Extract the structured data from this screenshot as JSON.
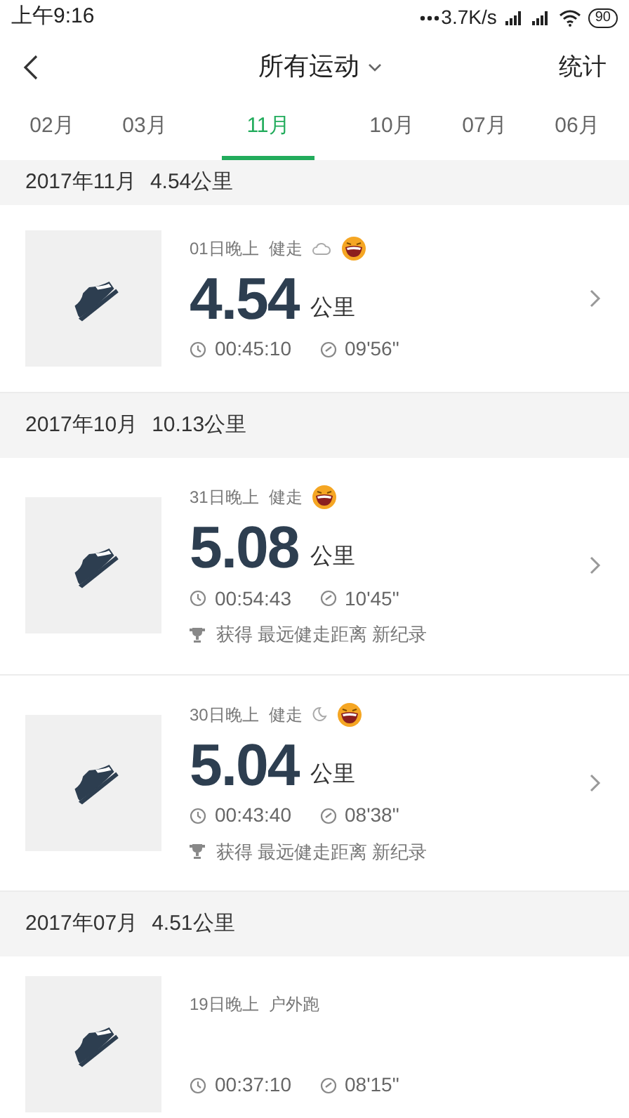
{
  "status_bar": {
    "time": "上午9:16",
    "speed": "3.7K/s",
    "battery": "90"
  },
  "header": {
    "title": "所有运动",
    "action": "统计"
  },
  "tabs": [
    {
      "label": "02月",
      "selected": false
    },
    {
      "label": "03月",
      "selected": false
    },
    {
      "label": "11月",
      "selected": true
    },
    {
      "label": "10月",
      "selected": false
    },
    {
      "label": "07月",
      "selected": false
    },
    {
      "label": "06月",
      "selected": false
    }
  ],
  "sections": [
    {
      "month": "2017年11月",
      "total": "4.54公里",
      "records": [
        {
          "time_label": "01日晚上",
          "sport": "健走",
          "weather": {
            "kind": "cloud"
          },
          "mood": true,
          "distance": "4.54",
          "unit": "公里",
          "duration": "00:45:10",
          "pace": "09'56\""
        }
      ]
    },
    {
      "month": "2017年10月",
      "total": "10.13公里",
      "records": [
        {
          "time_label": "31日晚上",
          "sport": "健走",
          "mood": true,
          "distance": "5.08",
          "unit": "公里",
          "duration": "00:54:43",
          "pace": "10'45\"",
          "achievement": "获得 最远健走距离 新纪录"
        },
        {
          "time_label": "30日晚上",
          "sport": "健走",
          "weather": {
            "kind": "moon"
          },
          "mood": true,
          "distance": "5.04",
          "unit": "公里",
          "duration": "00:43:40",
          "pace": "08'38\"",
          "achievement": "获得 最远健走距离 新纪录"
        }
      ]
    },
    {
      "month": "2017年07月",
      "total": "4.51公里",
      "records": [
        {
          "time_label": "19日晚上",
          "sport": "户外跑",
          "mood": false,
          "duration": "00:37:10",
          "pace": "08'15\""
        }
      ]
    }
  ]
}
